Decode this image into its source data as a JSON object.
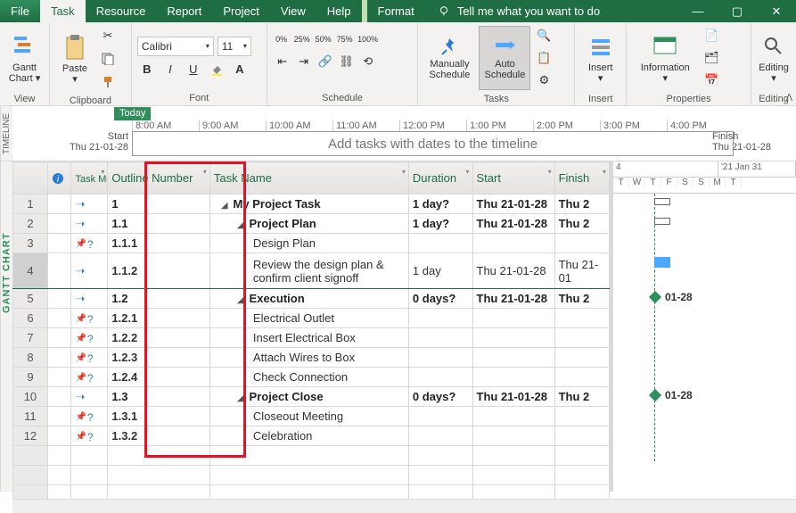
{
  "menu": {
    "file": "File",
    "task": "Task",
    "resource": "Resource",
    "report": "Report",
    "project": "Project",
    "view": "View",
    "help": "Help",
    "format": "Format",
    "tell": "Tell me what you want to do"
  },
  "ribbon": {
    "view_group": "View",
    "gantt_chart": "Gantt\nChart",
    "clipboard_group": "Clipboard",
    "paste": "Paste",
    "font_group": "Font",
    "font_name": "Calibri",
    "font_size": "11",
    "schedule_group": "Schedule",
    "manual": "Manually\nSchedule",
    "auto": "Auto\nSchedule",
    "tasks_group": "Tasks",
    "insert_group": "Insert",
    "insert": "Insert",
    "properties_group": "Properties",
    "information": "Information",
    "editing_group": "Editing",
    "editing": "Editing"
  },
  "timeline": {
    "side": "TIMELINE",
    "today": "Today",
    "times": [
      "8:00 AM",
      "9:00 AM",
      "10:00 AM",
      "11:00 AM",
      "12:00 PM",
      "1:00 PM",
      "2:00 PM",
      "3:00 PM",
      "4:00 PM"
    ],
    "start_label": "Start",
    "start_date": "Thu 21-01-28",
    "finish_label": "Finish",
    "finish_date": "Thu 21-01-28",
    "placeholder": "Add tasks with dates to the timeline"
  },
  "gantt_side": "GANTT CHART",
  "cols": {
    "info": "",
    "mode": "Task Mode",
    "outline": "Outline Number",
    "name": "Task Name",
    "duration": "Duration",
    "start": "Start",
    "finish": "Finish"
  },
  "chart_head": {
    "week1": "4",
    "week2": "'21 Jan 31",
    "days": [
      "T",
      "W",
      "T",
      "F",
      "S",
      "S",
      "M",
      "T"
    ]
  },
  "rows": [
    {
      "n": "1",
      "mode": "auto",
      "outline": "1",
      "name": "My Project Task",
      "indent": 0,
      "summary": true,
      "dur": "1 day?",
      "start": "Thu 21-01-28",
      "finish": "Thu 2"
    },
    {
      "n": "2",
      "mode": "auto",
      "outline": "1.1",
      "name": "Project Plan",
      "indent": 1,
      "summary": true,
      "dur": "1 day?",
      "start": "Thu 21-01-28",
      "finish": "Thu 2"
    },
    {
      "n": "3",
      "mode": "man",
      "outline": "1.1.1",
      "name": "Design Plan",
      "indent": 2,
      "summary": false,
      "dur": "",
      "start": "",
      "finish": ""
    },
    {
      "n": "4",
      "mode": "auto",
      "outline": "1.1.2",
      "name": "Review the design plan & confirm client signoff",
      "indent": 2,
      "summary": false,
      "dur": "1 day",
      "start": "Thu 21-01-28",
      "finish": "Thu 21-01",
      "selected": true,
      "wrap": true
    },
    {
      "n": "5",
      "mode": "auto",
      "outline": "1.2",
      "name": "Execution",
      "indent": 1,
      "summary": true,
      "dur": "0 days?",
      "start": "Thu 21-01-28",
      "finish": "Thu 2"
    },
    {
      "n": "6",
      "mode": "man",
      "outline": "1.2.1",
      "name": "Electrical Outlet",
      "indent": 2,
      "summary": false,
      "dur": "",
      "start": "",
      "finish": ""
    },
    {
      "n": "7",
      "mode": "man",
      "outline": "1.2.2",
      "name": "Insert Electrical Box",
      "indent": 2,
      "summary": false,
      "dur": "",
      "start": "",
      "finish": ""
    },
    {
      "n": "8",
      "mode": "man",
      "outline": "1.2.3",
      "name": "Attach Wires to Box",
      "indent": 2,
      "summary": false,
      "dur": "",
      "start": "",
      "finish": ""
    },
    {
      "n": "9",
      "mode": "man",
      "outline": "1.2.4",
      "name": "Check Connection",
      "indent": 2,
      "summary": false,
      "dur": "",
      "start": "",
      "finish": ""
    },
    {
      "n": "10",
      "mode": "auto",
      "outline": "1.3",
      "name": "Project Close",
      "indent": 1,
      "summary": true,
      "dur": "0 days?",
      "start": "Thu 21-01-28",
      "finish": "Thu 2"
    },
    {
      "n": "11",
      "mode": "man",
      "outline": "1.3.1",
      "name": "Closeout Meeting",
      "indent": 2,
      "summary": false,
      "dur": "",
      "start": "",
      "finish": ""
    },
    {
      "n": "12",
      "mode": "man",
      "outline": "1.3.2",
      "name": "Celebration",
      "indent": 2,
      "summary": false,
      "dur": "",
      "start": "",
      "finish": ""
    }
  ],
  "milestones": [
    {
      "row": 5,
      "label": "01-28"
    },
    {
      "row": 10,
      "label": "01-28"
    }
  ]
}
